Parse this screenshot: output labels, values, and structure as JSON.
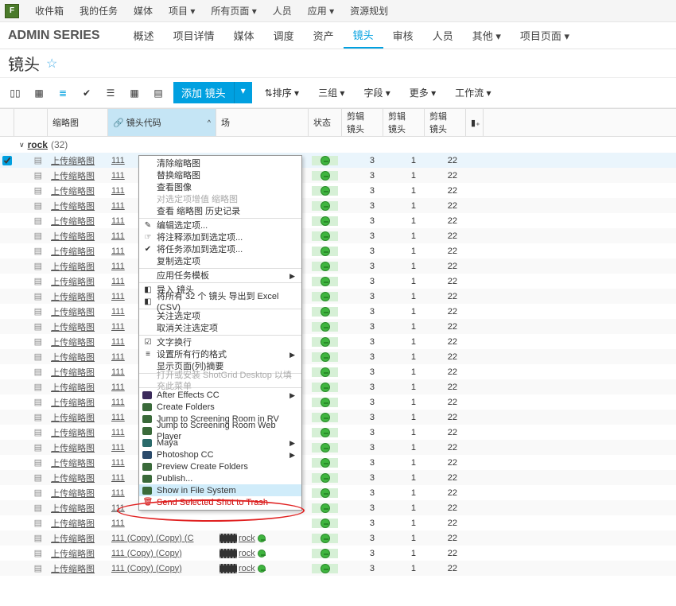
{
  "top_nav": [
    "收件箱",
    "我的任务",
    "媒体",
    "项目 ▾",
    "所有页面 ▾",
    "人员",
    "应用 ▾",
    "资源规划"
  ],
  "logo": "F",
  "project_title": "ADMIN SERIES",
  "project_nav": [
    {
      "label": "概述",
      "active": false
    },
    {
      "label": "项目详情",
      "active": false
    },
    {
      "label": "媒体",
      "active": false
    },
    {
      "label": "调度",
      "active": false
    },
    {
      "label": "资产",
      "active": false
    },
    {
      "label": "镜头",
      "active": true
    },
    {
      "label": "审核",
      "active": false
    },
    {
      "label": "人员",
      "active": false
    },
    {
      "label": "其他 ▾",
      "active": false
    },
    {
      "label": "项目页面 ▾",
      "active": false
    }
  ],
  "page_title": "镜头",
  "add_shot_label": "添加 镜头",
  "toolbar_labels": {
    "sort": "排序 ▾",
    "group": "三组 ▾",
    "fields": "字段 ▾",
    "more": "更多 ▾",
    "workflow": "工作流 ▾"
  },
  "columns": {
    "thumb": "缩略图",
    "code": "镜头代码",
    "scene": "场",
    "status": "状态",
    "edit1": "剪辑\n镜头",
    "edit2": "剪辑\n镜头",
    "edit3": "剪辑\n镜头",
    "add": "▮₊"
  },
  "group": {
    "name": "rock",
    "count": "(32)"
  },
  "thumb_link_label": "上传缩略图",
  "code": "111",
  "code_copy": "111 (Copy) (Copy) (C",
  "code_copy1": "111 (Copy) (Copy)",
  "rock_label": "rock",
  "nums": {
    "e1": "3",
    "e2": "1",
    "e3": "22"
  },
  "context_menu": [
    {
      "label": "清除缩略图",
      "icon": ""
    },
    {
      "label": "替换缩略图",
      "icon": ""
    },
    {
      "label": "查看图像",
      "icon": ""
    },
    {
      "label": "对选定项增值 缩略图",
      "icon": "",
      "disabled": true
    },
    {
      "label": "查看 缩略图 历史记录",
      "icon": ""
    },
    {
      "sep": true
    },
    {
      "label": "编辑选定项...",
      "icon": "✎"
    },
    {
      "label": "将注释添加到选定项...",
      "icon": "☞"
    },
    {
      "label": "将任务添加到选定项...",
      "icon": "✔"
    },
    {
      "label": "复制选定项",
      "icon": ""
    },
    {
      "sep": true
    },
    {
      "label": "应用任务模板",
      "icon": "",
      "submenu": true
    },
    {
      "sep": true
    },
    {
      "label": "导入 镜头",
      "icon": "◧"
    },
    {
      "label": "将所有 32 个 镜头 导出到 Excel (CSV)",
      "icon": "◧"
    },
    {
      "sep": true
    },
    {
      "label": "关注选定项",
      "icon": ""
    },
    {
      "label": "取消关注选定项",
      "icon": ""
    },
    {
      "sep": true
    },
    {
      "label": "文字换行",
      "icon": "☑"
    },
    {
      "label": "设置所有行的格式",
      "icon": "≡",
      "submenu": true
    },
    {
      "label": "显示页面(列)摘要",
      "icon": ""
    },
    {
      "sep": true
    },
    {
      "label": "打开或安装 ShotGrid Desktop 以填充此菜单",
      "icon": "",
      "disabled": true
    },
    {
      "sep": true
    },
    {
      "label": "After Effects CC",
      "icon": "app",
      "color": "#3a2a5a",
      "submenu": true
    },
    {
      "label": "Create Folders",
      "icon": "app",
      "color": "#3a6a3a"
    },
    {
      "label": "Jump to Screening Room in RV",
      "icon": "app",
      "color": "#3a6a3a"
    },
    {
      "label": "Jump to Screening Room Web Player",
      "icon": "app",
      "color": "#3a6a3a"
    },
    {
      "label": "Maya",
      "icon": "app",
      "color": "#2a6a6a",
      "submenu": true
    },
    {
      "label": "Photoshop CC",
      "icon": "app",
      "color": "#2a4a6a",
      "submenu": true
    },
    {
      "label": "Preview Create Folders",
      "icon": "app",
      "color": "#3a6a3a"
    },
    {
      "label": "Publish...",
      "icon": "app",
      "color": "#3a6a3a"
    },
    {
      "label": "Show in File System",
      "icon": "app",
      "color": "#3a6a3a",
      "highlight": true
    },
    {
      "label": "Send Selected Shot to Trash",
      "icon": "🗑",
      "red": true
    }
  ],
  "row_count_plain": 25,
  "row_count_copy": 3
}
